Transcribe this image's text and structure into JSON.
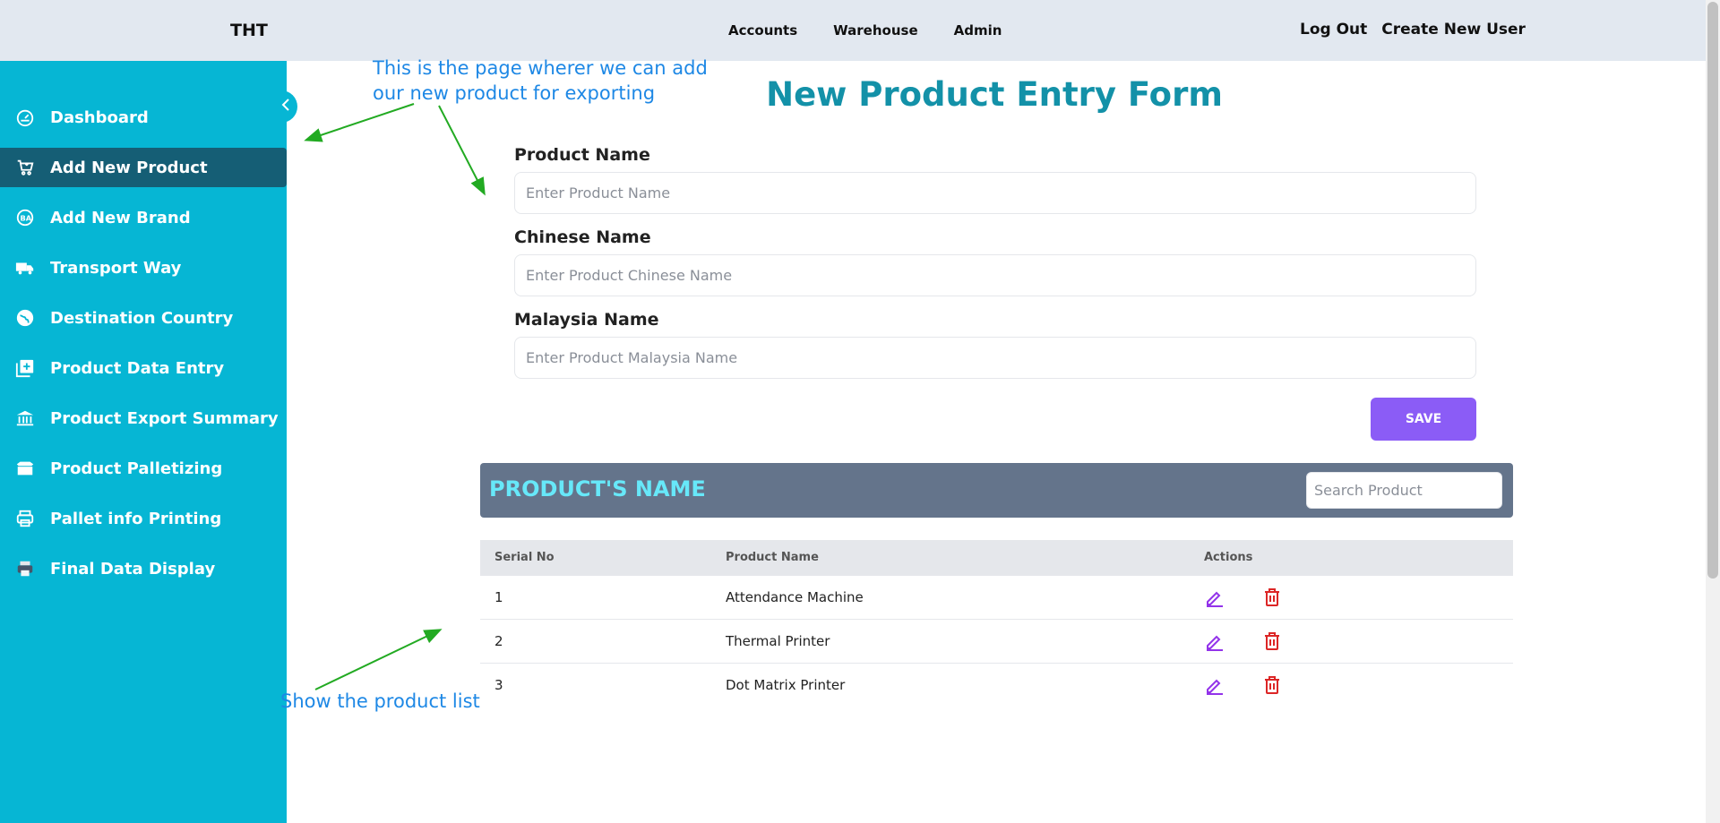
{
  "header": {
    "brand": "THT",
    "nav": [
      "Accounts",
      "Warehouse",
      "Admin"
    ],
    "logout": "Log Out",
    "create_user": "Create New User"
  },
  "sidebar": {
    "items": [
      {
        "label": "Dashboard",
        "icon": "dashboard-icon"
      },
      {
        "label": "Add New Product",
        "icon": "cart-icon",
        "active": true
      },
      {
        "label": "Add New Brand",
        "icon": "brand-icon"
      },
      {
        "label": "Transport Way",
        "icon": "truck-icon"
      },
      {
        "label": "Destination Country",
        "icon": "globe-icon"
      },
      {
        "label": "Product Data Entry",
        "icon": "library-add-icon"
      },
      {
        "label": "Product Export Summary",
        "icon": "bank-icon"
      },
      {
        "label": "Product Palletizing",
        "icon": "box-icon"
      },
      {
        "label": "Pallet info Printing",
        "icon": "printer-icon"
      },
      {
        "label": "Final Data Display",
        "icon": "printer-color-icon"
      }
    ]
  },
  "annotations": {
    "top_line1": "This is the page wherer we can add",
    "top_line2": "our new product for exporting",
    "bottom": "Show the product list"
  },
  "form": {
    "title": "New Product Entry Form",
    "fields": [
      {
        "label": "Product Name",
        "placeholder": "Enter Product Name",
        "value": ""
      },
      {
        "label": "Chinese Name",
        "placeholder": "Enter Product Chinese Name",
        "value": ""
      },
      {
        "label": "Malaysia Name",
        "placeholder": "Enter Product Malaysia Name",
        "value": ""
      }
    ],
    "save_label": "SAVE"
  },
  "list": {
    "title": "PRODUCT'S NAME",
    "search_placeholder": "Search Product",
    "columns": [
      "Serial No",
      "Product Name",
      "Actions"
    ],
    "rows": [
      {
        "serial": "1",
        "name": "Attendance Machine"
      },
      {
        "serial": "2",
        "name": "Thermal Printer"
      },
      {
        "serial": "3",
        "name": "Dot Matrix Printer"
      }
    ]
  },
  "colors": {
    "sidebar": "#06b6d4",
    "sidebar_active": "#155e75",
    "title": "#1391a8",
    "save": "#8b5cf6",
    "edit_icon": "#9333ea",
    "delete_icon": "#dc2626",
    "annotation": "#1e88e5",
    "arrow": "#22aa22"
  }
}
